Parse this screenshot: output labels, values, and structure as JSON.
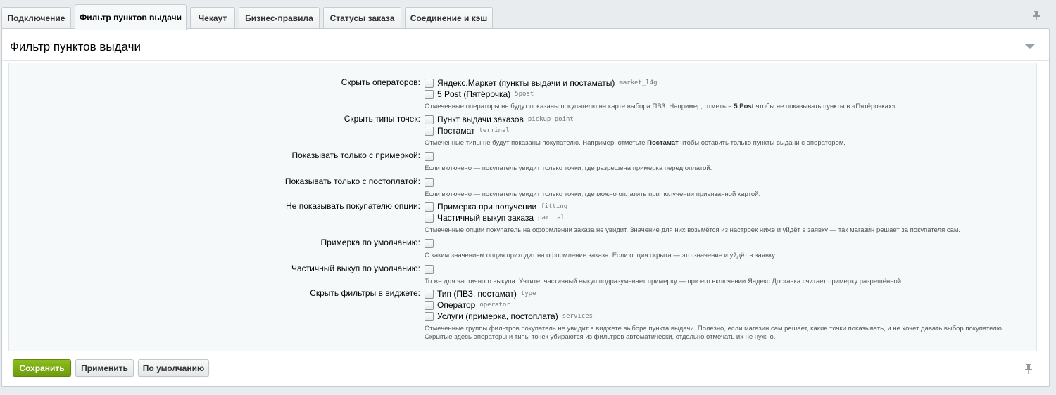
{
  "tabs": [
    {
      "label": "Подключение",
      "active": false
    },
    {
      "label": "Фильтр пунктов выдачи",
      "active": true
    },
    {
      "label": "Чекаут",
      "active": false
    },
    {
      "label": "Бизнес-правила",
      "active": false
    },
    {
      "label": "Статусы заказа",
      "active": false
    },
    {
      "label": "Соединение и кэш",
      "active": false
    }
  ],
  "panel": {
    "title": "Фильтр пунктов выдачи"
  },
  "form": {
    "hide_operators": {
      "label": "Скрыть операторов:",
      "options": [
        {
          "label": "Яндекс.Маркет (пункты выдачи и постаматы)",
          "code": "market_l4g",
          "checked": false
        },
        {
          "label": "5 Post (Пятёрочка)",
          "code": "5post",
          "checked": false
        }
      ],
      "hint_before": "Отмеченные операторы не будут показаны покупателю на карте выбора ПВЗ. Например, отметьте ",
      "hint_bold": "5 Post",
      "hint_after": " чтобы не показывать пункты в «Пятёрочках»."
    },
    "hide_point_types": {
      "label": "Скрыть типы точек:",
      "options": [
        {
          "label": "Пункт выдачи заказов",
          "code": "pickup_point",
          "checked": false
        },
        {
          "label": "Постамат",
          "code": "terminal",
          "checked": false
        }
      ],
      "hint_before": "Отмеченные типы не будут показаны покупателю. Например, отметьте ",
      "hint_bold": "Постамат",
      "hint_after": " чтобы оставить только пункты выдачи с оператором."
    },
    "fitting_only": {
      "label": "Показывать только с примеркой:",
      "checked": false,
      "hint": "Если включено — покупатель увидит только точки, где разрешена примерка перед оплатой."
    },
    "postpay_only": {
      "label": "Показывать только с постоплатой:",
      "checked": false,
      "hint": "Если включено — покупатель увидит только точки, где можно оплатить при получении привязанной картой."
    },
    "hide_options": {
      "label": "Не показывать покупателю опции:",
      "options": [
        {
          "label": "Примерка при получении",
          "code": "fitting",
          "checked": false
        },
        {
          "label": "Частичный выкуп заказа",
          "code": "partial",
          "checked": false
        }
      ],
      "hint": "Отмеченные опции покупатель на оформлении заказа не увидит. Значение для них возьмётся из настроек ниже и уйдёт в заявку — так магазин решает за покупателя сам."
    },
    "fitting_default": {
      "label": "Примерка по умолчанию:",
      "checked": false,
      "hint": "С каким значением опция приходит на оформление заказа. Если опция скрыта — это значение и уйдёт в заявку."
    },
    "partial_default": {
      "label": "Частичный выкуп по умолчанию:",
      "checked": false,
      "hint": "То же для частичного выкупа. Учтите: частичный выкуп подразумевает примерку — при его включении Яндекс Доставка считает примерку разрешённой."
    },
    "hide_widget_filters": {
      "label": "Скрыть фильтры в виджете:",
      "options": [
        {
          "label": "Тип (ПВЗ, постамат)",
          "code": "type",
          "checked": false
        },
        {
          "label": "Оператор",
          "code": "operator",
          "checked": false
        },
        {
          "label": "Услуги (примерка, постоплата)",
          "code": "services",
          "checked": false
        }
      ],
      "hint": "Отмеченные группы фильтров покупатель не увидит в виджете выбора пункта выдачи. Полезно, если магазин сам решает, какие точки показывать, и не хочет давать выбор покупателю. Скрытые здесь операторы и типы точек убираются из фильтров автоматически, отдельно отмечать их не нужно."
    }
  },
  "buttons": {
    "save": "Сохранить",
    "apply": "Применить",
    "default": "По умолчанию"
  },
  "icons": {
    "pin": "pin-icon",
    "collapse": "chevron-down-icon"
  },
  "colors": {
    "save_button": "#7aa912",
    "background": "#e8ecef",
    "form_area": "#f5f9f9"
  }
}
